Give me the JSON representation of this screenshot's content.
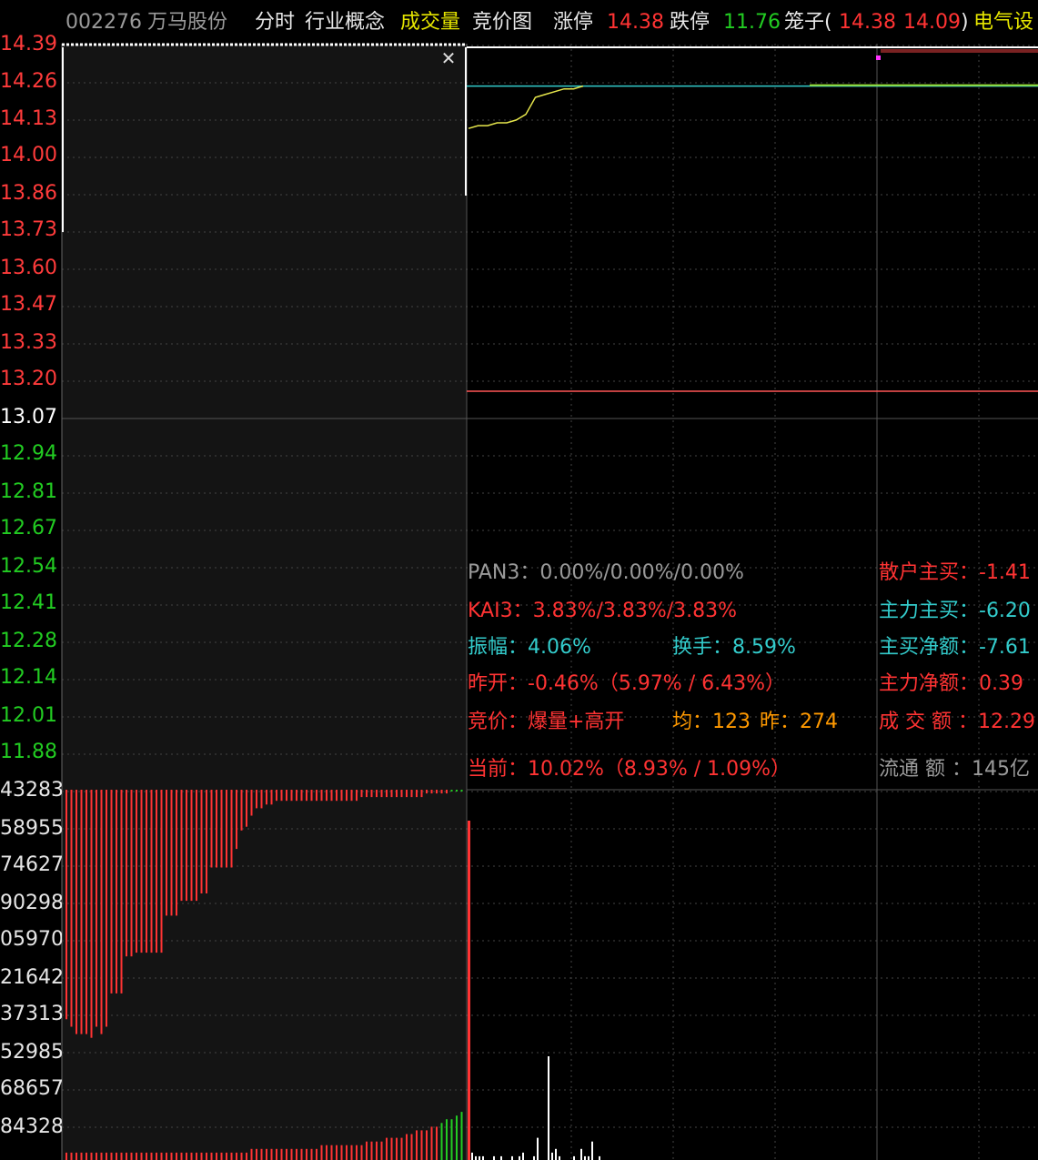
{
  "header": {
    "code": "002276",
    "name": "万马股份",
    "tab_intraday": "分时",
    "tab_industry": "行业概念",
    "tab_volume": "成交量",
    "tab_auction": "竞价图",
    "limit_up_label": "涨停",
    "limit_up_value": "14.38",
    "limit_down_label": "跌停",
    "limit_down_value": "11.76",
    "cage_label": "笼子(",
    "cage_high": "14.38",
    "cage_low": "14.09",
    "cage_close": ")",
    "sector": "电气设"
  },
  "price_axis": {
    "ticks": [
      "14.39",
      "14.26",
      "14.13",
      "14.00",
      "13.86",
      "13.73",
      "13.60",
      "13.47",
      "13.33",
      "13.20",
      "13.07",
      "12.94",
      "12.81",
      "12.67",
      "12.54",
      "12.41",
      "12.28",
      "12.14",
      "12.01",
      "11.88"
    ],
    "prev_close": "13.07"
  },
  "volume_axis": {
    "ticks": [
      "43283",
      "58955",
      "74627",
      "90298",
      "05970",
      "21642",
      "37313",
      "52985",
      "68657",
      "84328"
    ]
  },
  "info": {
    "pan3": "PAN3：0.00%/0.00%/0.00%",
    "kai3": "KAI3：3.83%/3.83%/3.83%",
    "amplitude": "振幅：4.06%",
    "turnover": "换手：8.59%",
    "prev_open": "昨开：-0.46%（5.97% / 6.43%）",
    "auction": "竞价：爆量+高开",
    "avg": "均：123",
    "prev": "昨：274",
    "current": "当前：10.02%（8.93% / 1.09%）",
    "retail_buy": "散户主买：-1.41",
    "main_buy": "主力主买：-6.20",
    "net_buy": "主买净额：-7.61",
    "main_net": "主力净额：0.39",
    "amount": "成 交 额 ：12.29",
    "float_cap": "流通 额 ：145亿"
  },
  "colors": {
    "up": "#ff3333",
    "down": "#22cc22",
    "avg_line": "#e6e64c",
    "ref_line": "#33cccc",
    "prev_close_line": "#ff5555",
    "panel_bg": "#141414",
    "grid": "#444444"
  },
  "chart_data": {
    "type": "line",
    "price_series": {
      "name": "",
      "values": [
        14.09,
        14.1,
        14.1,
        14.11,
        14.11,
        14.12,
        14.14,
        14.2,
        14.21,
        14.22,
        14.23,
        14.23,
        14.24
      ]
    },
    "ref_price": 14.24,
    "prev_close": 13.07,
    "ylim": [
      11.88,
      14.39
    ],
    "auction_matched_volume": [
      0.62,
      0.64,
      0.66,
      0.66,
      0.66,
      0.67,
      0.64,
      0.66,
      0.64,
      0.55,
      0.55,
      0.55,
      0.45,
      0.45,
      0.44,
      0.44,
      0.44,
      0.44,
      0.44,
      0.44,
      0.34,
      0.34,
      0.34,
      0.3,
      0.3,
      0.3,
      0.3,
      0.28,
      0.28,
      0.21,
      0.21,
      0.21,
      0.21,
      0.21,
      0.16,
      0.11,
      0.1,
      0.07,
      0.05,
      0.05,
      0.04,
      0.04,
      0.03,
      0.03,
      0.03,
      0.03,
      0.03,
      0.03,
      0.03,
      0.03,
      0.03,
      0.03,
      0.03,
      0.03,
      0.03,
      0.03,
      0.03,
      0.03,
      0.03,
      0.02,
      0.02,
      0.02,
      0.02,
      0.02,
      0.02,
      0.02,
      0.02,
      0.02,
      0.02,
      0.02,
      0.02,
      0.02,
      0.01,
      0.01,
      0.01,
      0.01,
      0.01,
      0.0,
      0.0,
      0.0
    ],
    "auction_unmatched_volume": [
      0.02,
      0.02,
      0.02,
      0.02,
      0.02,
      0.02,
      0.02,
      0.02,
      0.02,
      0.02,
      0.02,
      0.02,
      0.02,
      0.02,
      0.02,
      0.02,
      0.02,
      0.02,
      0.02,
      0.02,
      0.02,
      0.02,
      0.02,
      0.02,
      0.02,
      0.02,
      0.02,
      0.02,
      0.02,
      0.02,
      0.02,
      0.02,
      0.02,
      0.02,
      0.02,
      0.02,
      0.02,
      0.03,
      0.03,
      0.03,
      0.03,
      0.03,
      0.03,
      0.03,
      0.03,
      0.03,
      0.03,
      0.03,
      0.03,
      0.03,
      0.03,
      0.04,
      0.04,
      0.04,
      0.04,
      0.04,
      0.04,
      0.04,
      0.04,
      0.04,
      0.05,
      0.05,
      0.05,
      0.05,
      0.06,
      0.06,
      0.06,
      0.06,
      0.07,
      0.07,
      0.08,
      0.08,
      0.08,
      0.09,
      0.09,
      0.1,
      0.11,
      0.11,
      0.12,
      0.13
    ],
    "trade_volume": [
      0.02,
      0.01,
      0.01,
      0.01,
      0.0,
      0.0,
      0.01,
      0.0,
      0.01,
      0.0,
      0.0,
      0.01,
      0.0,
      0.01,
      0.02,
      0.0,
      0.0,
      0.01,
      0.06,
      0.0,
      0.0,
      0.28,
      0.02,
      0.03,
      0.01,
      0.0,
      0.0,
      0.0,
      0.01,
      0.0,
      0.03,
      0.01,
      0.01,
      0.05,
      0.0,
      0.01
    ],
    "ylabel": "",
    "xlabel": ""
  }
}
